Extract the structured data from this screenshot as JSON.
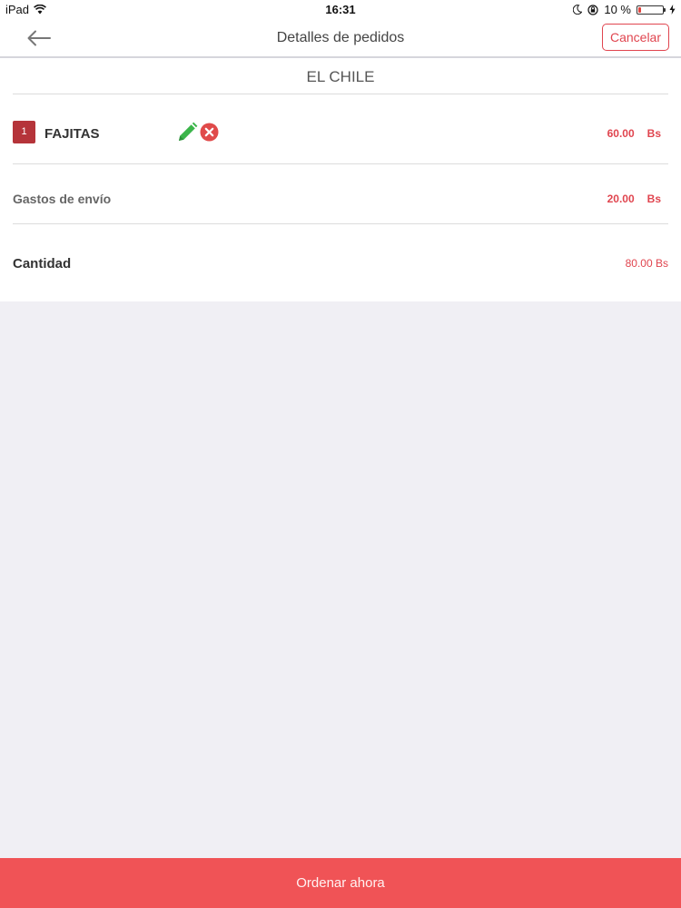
{
  "status_bar": {
    "device": "iPad",
    "time": "16:31",
    "battery_text": "10 %",
    "battery_level": 0.1,
    "icons": [
      "wifi-icon",
      "moon-icon",
      "rotation-lock-icon",
      "battery-icon",
      "charging-icon"
    ]
  },
  "nav": {
    "title": "Detalles de pedidos",
    "cancel_label": "Cancelar",
    "back_icon": "back-arrow-icon"
  },
  "order": {
    "restaurant": "EL CHILE",
    "items": [
      {
        "quantity": "1",
        "name": "FAJITAS",
        "price": "60.00",
        "currency": "Bs",
        "edit_icon": "pencil-icon",
        "remove_icon": "remove-circle-icon"
      }
    ],
    "shipping": {
      "label": "Gastos de envío",
      "price": "20.00",
      "currency": "Bs"
    },
    "total": {
      "label": "Cantidad",
      "value": "80.00 Bs"
    }
  },
  "footer": {
    "order_button_label": "Ordenar ahora"
  },
  "colors": {
    "accent": "#e0454f",
    "button_bg": "#f05356",
    "badge_bg": "#b5343a",
    "edit_green": "#3bb54a",
    "remove_red": "#e04a4a",
    "background": "#f0eff4"
  }
}
